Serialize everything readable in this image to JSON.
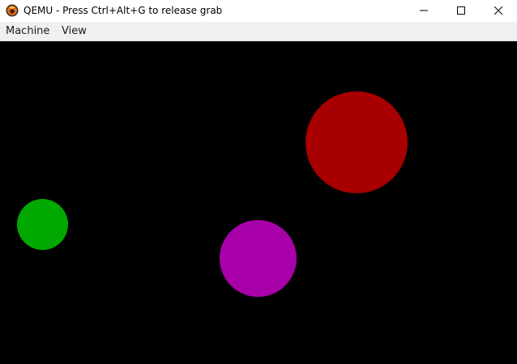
{
  "window": {
    "title": "QEMU - Press Ctrl+Alt+G to release grab",
    "app_icon": "qemu-icon",
    "controls": {
      "minimize_icon": "minimize-icon",
      "maximize_icon": "maximize-icon",
      "close_icon": "close-icon"
    }
  },
  "menubar": {
    "items": [
      {
        "label": "Machine"
      },
      {
        "label": "View"
      }
    ]
  },
  "display": {
    "background": "#000000",
    "balls": [
      {
        "color": "#a80000"
      },
      {
        "color": "#00a800"
      },
      {
        "color": "#a800a8"
      }
    ]
  }
}
